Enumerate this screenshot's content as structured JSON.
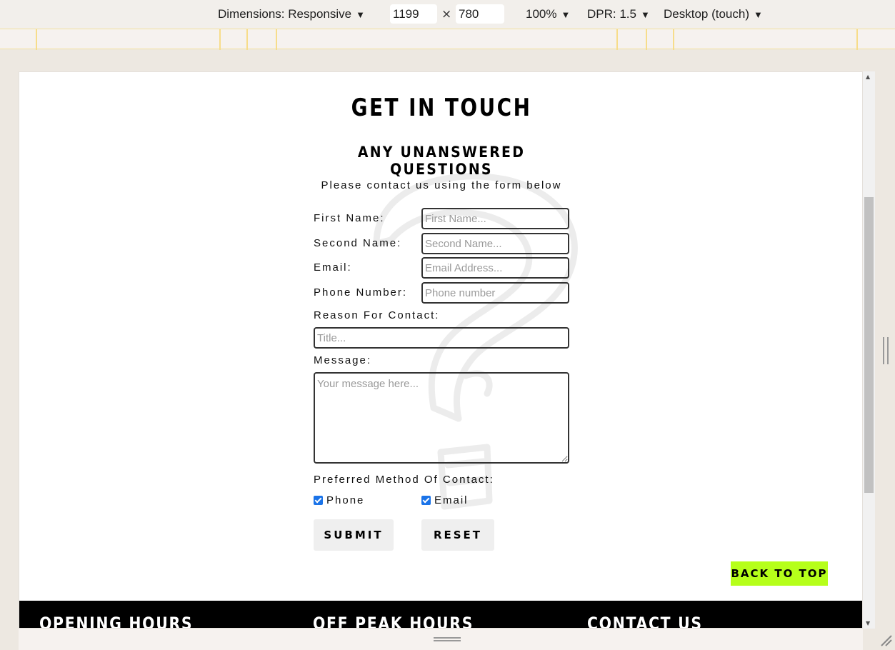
{
  "devtools": {
    "dimensions_label": "Dimensions: Responsive",
    "width": "1199",
    "height": "780",
    "times": "×",
    "zoom": "100%",
    "dpr": "DPR: 1.5",
    "device": "Desktop (touch)",
    "caret": "▼"
  },
  "page": {
    "title": "GET IN TOUCH",
    "subtitle": "ANY UNANSWERED QUESTIONS",
    "intro": "Please contact us using the form below",
    "form": {
      "first_name_label": "First Name:",
      "first_name_placeholder": "First Name...",
      "second_name_label": "Second Name:",
      "second_name_placeholder": "Second Name...",
      "email_label": "Email:",
      "email_placeholder": "Email Address...",
      "phone_label": "Phone Number:",
      "phone_placeholder": "Phone number",
      "reason_label": "Reason For Contact:",
      "reason_placeholder": "Title...",
      "message_label": "Message:",
      "message_placeholder": "Your message here...",
      "preferred_label": "Preferred Method Of Contact:",
      "phone_option": "Phone",
      "email_option": "Email",
      "phone_checked": true,
      "email_checked": true,
      "submit_label": "SUBMIT",
      "reset_label": "RESET"
    },
    "back_to_top": "BACK TO TOP",
    "footer": {
      "opening_hours": "OPENING HOURS",
      "off_peak_hours": "OFF PEAK HOURS",
      "contact_us": "CONTACT US"
    }
  },
  "colors": {
    "accent": "#b6ff1a",
    "checkbox": "#1a73e8",
    "footer_bg": "#000000"
  }
}
